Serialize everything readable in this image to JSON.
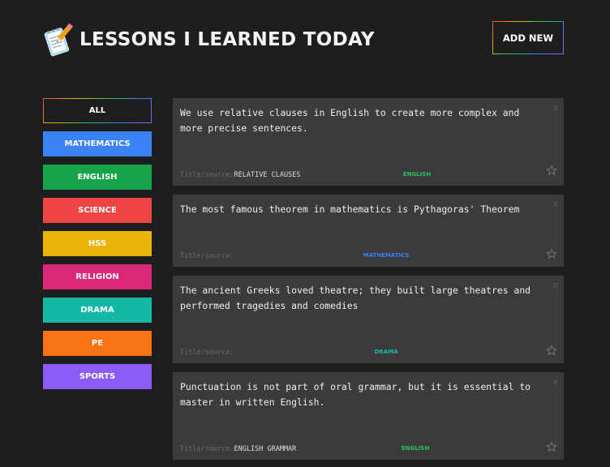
{
  "header": {
    "title": "LESSONS I LEARNED TODAY",
    "add_new_label": "ADD NEW",
    "logo_icon": "notepad-pencil-icon"
  },
  "sidebar": {
    "items": [
      {
        "label": "ALL",
        "color": "#1e1e20"
      },
      {
        "label": "MATHEMATICS",
        "color": "#3b82f6"
      },
      {
        "label": "ENGLISH",
        "color": "#16a34a"
      },
      {
        "label": "SCIENCE",
        "color": "#ef4444"
      },
      {
        "label": "HSS",
        "color": "#eab308"
      },
      {
        "label": "RELIGION",
        "color": "#db2777"
      },
      {
        "label": "DRAMA",
        "color": "#14b8a6"
      },
      {
        "label": "PE",
        "color": "#f97316"
      },
      {
        "label": "SPORTS",
        "color": "#8b5cf6"
      }
    ]
  },
  "facts": [
    {
      "text": "We use relative clauses in English to create more complex and more precise sentences.",
      "source_label": "Title/source:",
      "source": "RELATIVE CLAUSES",
      "category": "ENGLISH",
      "category_color": "#22c55e",
      "close": "x",
      "star_icon": "star-outline-icon"
    },
    {
      "text": "The most famous theorem in mathematics is Pythagoras' Theorem",
      "source_label": "Title/source:",
      "source": "",
      "category": "MATHEMATICS",
      "category_color": "#3b82f6",
      "close": "x",
      "star_icon": "star-outline-icon"
    },
    {
      "text": "The ancient Greeks loved theatre; they built large theatres and performed tragedies and comedies",
      "source_label": "Title/source:",
      "source": "",
      "category": "DRAMA",
      "category_color": "#14b8a6",
      "close": "x",
      "star_icon": "star-outline-icon"
    },
    {
      "text": "Punctuation is not part of oral grammar, but it is essential to master in written English.",
      "source_label": "Title/source:",
      "source": "ENGLISH GRAMMAR",
      "category": "ENGLISH",
      "category_color": "#22c55e",
      "close": "x",
      "star_icon": "star-outline-icon"
    }
  ]
}
